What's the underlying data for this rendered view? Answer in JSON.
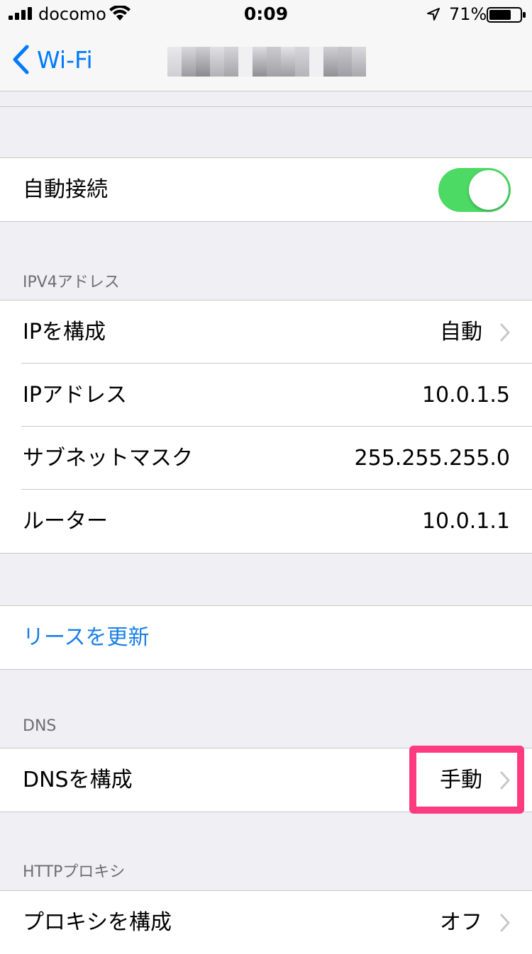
{
  "status_bar": {
    "carrier": "docomo",
    "time": "0:09",
    "battery_percent": "71%"
  },
  "nav_bar": {
    "back_label": "Wi-Fi"
  },
  "auto_join": {
    "label": "自動接続",
    "enabled": true
  },
  "ipv4": {
    "header": "IPV4アドレス",
    "rows": [
      {
        "label": "IPを構成",
        "value": "自動"
      },
      {
        "label": "IPアドレス",
        "value": "10.0.1.5"
      },
      {
        "label": "サブネットマスク",
        "value": "255.255.255.0"
      },
      {
        "label": "ルーター",
        "value": "10.0.1.1"
      }
    ]
  },
  "renew_lease": {
    "label": "リースを更新"
  },
  "dns": {
    "header": "DNS",
    "label": "DNSを構成",
    "value": "手動"
  },
  "http_proxy": {
    "header": "HTTPプロキシ",
    "label": "プロキシを構成",
    "value": "オフ"
  },
  "colors": {
    "accent": "#007aff",
    "toggle_on": "#4cd964",
    "highlight": "#ff3b7f"
  }
}
